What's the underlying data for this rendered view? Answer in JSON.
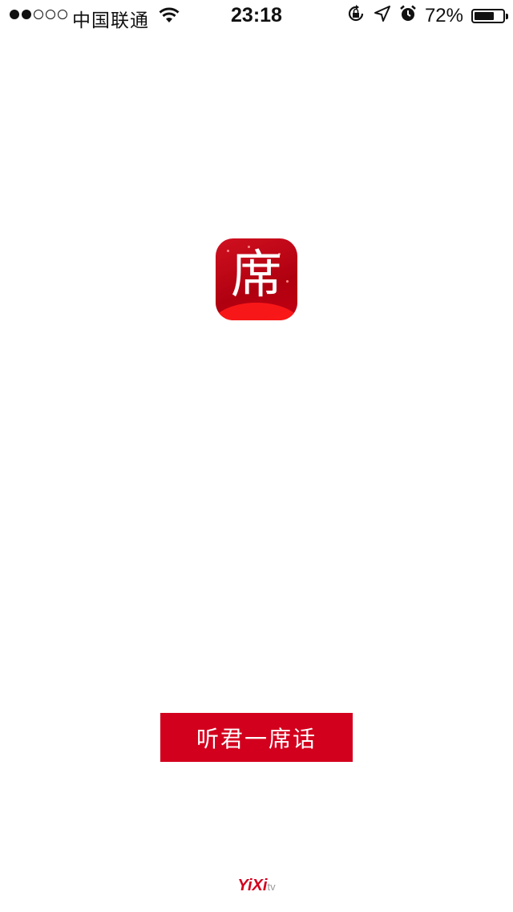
{
  "status_bar": {
    "carrier": "中国联通",
    "time": "23:18",
    "battery_percent": "72%",
    "battery_level": 0.72,
    "signal_bars_filled": 2,
    "signal_bars_total": 5
  },
  "logo": {
    "character": "席",
    "brand_color": "#d3001d"
  },
  "cta": {
    "label": "听君一席话"
  },
  "footer": {
    "brand_main": "YiXi",
    "brand_suffix": "tv"
  }
}
